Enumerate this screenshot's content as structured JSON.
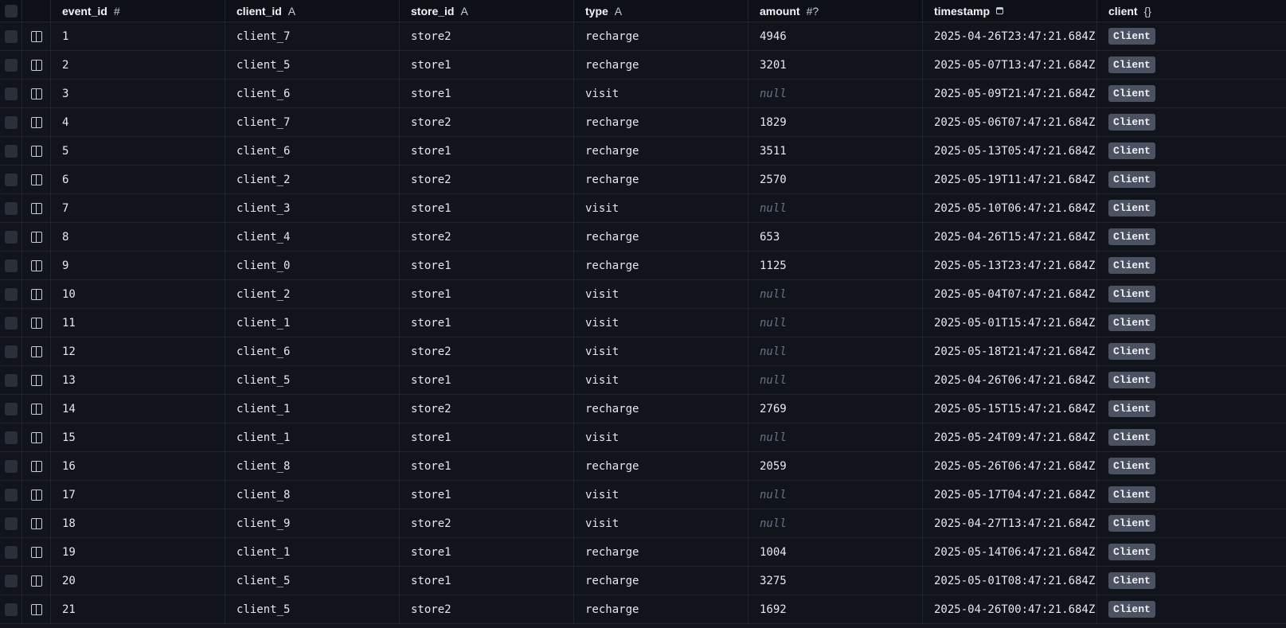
{
  "columns": {
    "event_id": {
      "label": "event_id",
      "type_glyph": "#"
    },
    "client_id": {
      "label": "client_id",
      "type_glyph": "A"
    },
    "store_id": {
      "label": "store_id",
      "type_glyph": "A"
    },
    "type": {
      "label": "type",
      "type_glyph": "A"
    },
    "amount": {
      "label": "amount",
      "type_glyph": "#?"
    },
    "timestamp": {
      "label": "timestamp",
      "type_glyph": "calendar-icon"
    },
    "client": {
      "label": "client",
      "type_glyph": "{}"
    }
  },
  "null_label": "null",
  "relation_label": "Client",
  "rows": [
    {
      "event_id": "1",
      "client_id": "client_7",
      "store_id": "store2",
      "type": "recharge",
      "amount": "4946",
      "timestamp": "2025-04-26T23:47:21.684Z"
    },
    {
      "event_id": "2",
      "client_id": "client_5",
      "store_id": "store1",
      "type": "recharge",
      "amount": "3201",
      "timestamp": "2025-05-07T13:47:21.684Z"
    },
    {
      "event_id": "3",
      "client_id": "client_6",
      "store_id": "store1",
      "type": "visit",
      "amount": null,
      "timestamp": "2025-05-09T21:47:21.684Z"
    },
    {
      "event_id": "4",
      "client_id": "client_7",
      "store_id": "store2",
      "type": "recharge",
      "amount": "1829",
      "timestamp": "2025-05-06T07:47:21.684Z"
    },
    {
      "event_id": "5",
      "client_id": "client_6",
      "store_id": "store1",
      "type": "recharge",
      "amount": "3511",
      "timestamp": "2025-05-13T05:47:21.684Z"
    },
    {
      "event_id": "6",
      "client_id": "client_2",
      "store_id": "store2",
      "type": "recharge",
      "amount": "2570",
      "timestamp": "2025-05-19T11:47:21.684Z"
    },
    {
      "event_id": "7",
      "client_id": "client_3",
      "store_id": "store1",
      "type": "visit",
      "amount": null,
      "timestamp": "2025-05-10T06:47:21.684Z"
    },
    {
      "event_id": "8",
      "client_id": "client_4",
      "store_id": "store2",
      "type": "recharge",
      "amount": "653",
      "timestamp": "2025-04-26T15:47:21.684Z"
    },
    {
      "event_id": "9",
      "client_id": "client_0",
      "store_id": "store1",
      "type": "recharge",
      "amount": "1125",
      "timestamp": "2025-05-13T23:47:21.684Z"
    },
    {
      "event_id": "10",
      "client_id": "client_2",
      "store_id": "store1",
      "type": "visit",
      "amount": null,
      "timestamp": "2025-05-04T07:47:21.684Z"
    },
    {
      "event_id": "11",
      "client_id": "client_1",
      "store_id": "store1",
      "type": "visit",
      "amount": null,
      "timestamp": "2025-05-01T15:47:21.684Z"
    },
    {
      "event_id": "12",
      "client_id": "client_6",
      "store_id": "store2",
      "type": "visit",
      "amount": null,
      "timestamp": "2025-05-18T21:47:21.684Z"
    },
    {
      "event_id": "13",
      "client_id": "client_5",
      "store_id": "store1",
      "type": "visit",
      "amount": null,
      "timestamp": "2025-04-26T06:47:21.684Z"
    },
    {
      "event_id": "14",
      "client_id": "client_1",
      "store_id": "store2",
      "type": "recharge",
      "amount": "2769",
      "timestamp": "2025-05-15T15:47:21.684Z"
    },
    {
      "event_id": "15",
      "client_id": "client_1",
      "store_id": "store1",
      "type": "visit",
      "amount": null,
      "timestamp": "2025-05-24T09:47:21.684Z"
    },
    {
      "event_id": "16",
      "client_id": "client_8",
      "store_id": "store1",
      "type": "recharge",
      "amount": "2059",
      "timestamp": "2025-05-26T06:47:21.684Z"
    },
    {
      "event_id": "17",
      "client_id": "client_8",
      "store_id": "store1",
      "type": "visit",
      "amount": null,
      "timestamp": "2025-05-17T04:47:21.684Z"
    },
    {
      "event_id": "18",
      "client_id": "client_9",
      "store_id": "store2",
      "type": "visit",
      "amount": null,
      "timestamp": "2025-04-27T13:47:21.684Z"
    },
    {
      "event_id": "19",
      "client_id": "client_1",
      "store_id": "store1",
      "type": "recharge",
      "amount": "1004",
      "timestamp": "2025-05-14T06:47:21.684Z"
    },
    {
      "event_id": "20",
      "client_id": "client_5",
      "store_id": "store1",
      "type": "recharge",
      "amount": "3275",
      "timestamp": "2025-05-01T08:47:21.684Z"
    },
    {
      "event_id": "21",
      "client_id": "client_5",
      "store_id": "store2",
      "type": "recharge",
      "amount": "1692",
      "timestamp": "2025-04-26T00:47:21.684Z"
    }
  ]
}
